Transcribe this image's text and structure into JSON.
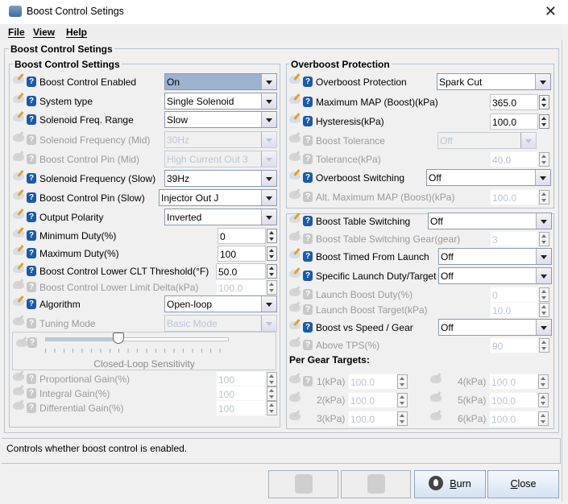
{
  "window": {
    "title": "Boost Control Setings",
    "close_icon": "close-icon"
  },
  "menu": [
    "File",
    "View",
    "Help"
  ],
  "outer_title": "Boost Control Setings",
  "left": {
    "title": "Boost Control Settings",
    "rows": [
      {
        "label": "Boost Control Enabled",
        "type": "combo",
        "value": "On",
        "enabled": true,
        "selected": true
      },
      {
        "label": "System type",
        "type": "combo",
        "value": "Single Solenoid",
        "enabled": true
      },
      {
        "label": "Solenoid Freq. Range",
        "type": "combo",
        "value": "Slow",
        "enabled": true
      },
      {
        "label": "Solenoid Frequency (Mid)",
        "type": "combo",
        "value": "30Hz",
        "enabled": false
      },
      {
        "label": "Boost Control Pin (Mid)",
        "type": "combo",
        "value": "High Current Out 3",
        "enabled": false
      },
      {
        "label": "Solenoid Frequency (Slow)",
        "type": "combo",
        "value": "39Hz",
        "enabled": true
      },
      {
        "label": "Boost Control Pin (Slow)",
        "type": "combo",
        "value": "Injector Out J",
        "enabled": true
      },
      {
        "label": "Output Polarity",
        "type": "combo",
        "value": "Inverted",
        "enabled": true
      },
      {
        "label": "Minimum Duty(%)",
        "type": "spin",
        "value": "0",
        "enabled": true
      },
      {
        "label": "Maximum Duty(%)",
        "type": "spin",
        "value": "100",
        "enabled": true
      },
      {
        "label": "Boost Control Lower CLT Threshold(°F)",
        "type": "spin",
        "value": "50.0",
        "enabled": true
      },
      {
        "label": "Boost Control Lower Limit Delta(kPa)",
        "type": "spin",
        "value": "100.0",
        "enabled": false
      },
      {
        "label": "Algorithm",
        "type": "combo",
        "value": "Open-loop",
        "enabled": true
      },
      {
        "label": "Tuning Mode",
        "type": "combo",
        "value": "Basic Mode",
        "enabled": false
      }
    ],
    "slider": {
      "label": "Closed-Loop Sensitivity",
      "value_fraction": 0.4,
      "enabled": false
    },
    "gains": [
      {
        "label": "Proportional Gain(%)",
        "value": "100",
        "enabled": false
      },
      {
        "label": "Integral Gain(%)",
        "value": "100",
        "enabled": false
      },
      {
        "label": "Differential Gain(%)",
        "value": "100",
        "enabled": false
      }
    ]
  },
  "right": {
    "title": "Overboost Protection",
    "rows": [
      {
        "label": "Overboost Protection",
        "type": "combo",
        "value": "Spark Cut",
        "enabled": true
      },
      {
        "label": "Maximum MAP (Boost)(kPa)",
        "type": "spin",
        "value": "365.0",
        "enabled": true
      },
      {
        "label": "Hysteresis(kPa)",
        "type": "spin",
        "value": "100.0",
        "enabled": true
      },
      {
        "label": "Boost Tolerance",
        "type": "combo",
        "value": "Off",
        "enabled": false
      },
      {
        "label": "Tolerance(kPa)",
        "type": "spin",
        "value": "40.0",
        "enabled": false
      },
      {
        "label": "Overboost Switching",
        "type": "combo",
        "value": "Off",
        "enabled": true
      },
      {
        "label": "Alt. Maximum MAP (Boost)(kPa)",
        "type": "spin",
        "value": "100.0",
        "enabled": false
      }
    ],
    "rows2": [
      {
        "label": "Boost Table Switching",
        "type": "combo",
        "value": "Off",
        "enabled": true
      },
      {
        "label": "Boost Table Switching Gear(gear)",
        "type": "spin",
        "value": "3",
        "enabled": false
      },
      {
        "label": "Boost Timed From Launch",
        "type": "combo",
        "value": "Off",
        "enabled": true
      },
      {
        "label": "Specific Launch Duty/Target",
        "type": "combo",
        "value": "Off",
        "enabled": true
      },
      {
        "label": "Launch Boost Duty(%)",
        "type": "spin",
        "value": "0",
        "enabled": false
      },
      {
        "label": "Launch Boost Target(kPa)",
        "type": "spin",
        "value": "10.0",
        "enabled": false
      },
      {
        "label": "Boost vs Speed / Gear",
        "type": "combo",
        "value": "Off",
        "enabled": true
      },
      {
        "label": "Above TPS(%)",
        "type": "spin",
        "value": "90",
        "enabled": false
      }
    ],
    "per_gear_title": "Per Gear Targets:",
    "gears": [
      {
        "label": "1(kPa)",
        "value": "100.0"
      },
      {
        "label": "2(kPa)",
        "value": "100.0"
      },
      {
        "label": "3(kPa)",
        "value": "100.0"
      },
      {
        "label": "4(kPa)",
        "value": "100.0"
      },
      {
        "label": "5(kPa)",
        "value": "100.0"
      },
      {
        "label": "6(kPa)",
        "value": "100.0"
      }
    ]
  },
  "status": "Controls whether boost control is enabled.",
  "buttons": {
    "undo_icon": "undo-icon",
    "redo_icon": "redo-icon",
    "burn": "Burn",
    "burn_key": "B",
    "close": "Close",
    "close_key": "C"
  },
  "colors": {
    "help_icon": "#1a5aa8",
    "selected_combo": "#9cb3cf"
  }
}
